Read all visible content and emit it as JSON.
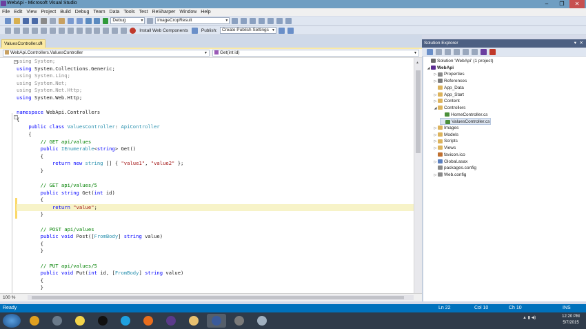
{
  "window": {
    "title": "WebApi - Microsoft Visual Studio",
    "controls": [
      "–",
      "❐",
      "✕"
    ]
  },
  "menubar": {
    "items": [
      "File",
      "Edit",
      "View",
      "Project",
      "Build",
      "Debug",
      "Team",
      "Data",
      "Tools",
      "Test",
      "ReSharper",
      "Window",
      "Help"
    ]
  },
  "toolbar1": {
    "config": "Debug",
    "find": "imageCropResult"
  },
  "toolbar2": {
    "install_label": "Install Web Components",
    "publish_label": "Publish:",
    "publish_profile": "Create Publish Settings"
  },
  "tabs": {
    "active": "ValuesController.cs",
    "close": "✕"
  },
  "navbar": {
    "type": "WebApi.Controllers.ValuesController",
    "member": "Get(int id)"
  },
  "editor": {
    "zoom": "100 %",
    "lines": [
      [
        [
          "gr",
          "using System;"
        ]
      ],
      [
        [
          "kw",
          "using"
        ],
        [
          "",
          "System.Collections.Generic;"
        ]
      ],
      [
        [
          "gr",
          "using System.Linq;"
        ]
      ],
      [
        [
          "gr",
          "using System.Net;"
        ]
      ],
      [
        [
          "gr",
          "using System.Net.Http;"
        ]
      ],
      [
        [
          "kw",
          "using"
        ],
        [
          "",
          "System.Web.Http;"
        ]
      ],
      [
        [
          "",
          ""
        ]
      ],
      [
        [
          "kw",
          "namespace"
        ],
        [
          "",
          "WebApi.Controllers"
        ]
      ],
      [
        [
          "",
          "{"
        ]
      ],
      [
        [
          "",
          "    "
        ],
        [
          "kw",
          "public class"
        ],
        [
          "",
          ""
        ],
        [
          "ty",
          "ValuesController"
        ],
        [
          "",
          ":"
        ],
        [
          "ty",
          "ApiController"
        ]
      ],
      [
        [
          "",
          "    {"
        ]
      ],
      [
        [
          "",
          "        "
        ],
        [
          "cm",
          "// GET api/values"
        ]
      ],
      [
        [
          "",
          "        "
        ],
        [
          "kw",
          "public"
        ],
        [
          "",
          ""
        ],
        [
          "ty",
          "IEnumerable"
        ],
        [
          "",
          "<"
        ],
        [
          "kw",
          "string"
        ],
        [
          "",
          "> Get()"
        ]
      ],
      [
        [
          "",
          "        {"
        ]
      ],
      [
        [
          "",
          "            "
        ],
        [
          "kw",
          "return new"
        ],
        [
          "",
          ""
        ],
        [
          "ty",
          "string"
        ],
        [
          "",
          "[] { "
        ],
        [
          "str",
          "\"value1\""
        ],
        [
          "",
          ", "
        ],
        [
          "str",
          "\"value2\""
        ],
        [
          "",
          " };"
        ]
      ],
      [
        [
          "",
          "        }"
        ]
      ],
      [
        [
          "",
          ""
        ]
      ],
      [
        [
          "",
          "        "
        ],
        [
          "cm",
          "// GET api/values/5"
        ]
      ],
      [
        [
          "",
          "        "
        ],
        [
          "kw",
          "public string"
        ],
        [
          "",
          "Get("
        ],
        [
          "kw",
          "int"
        ],
        [
          "",
          "id)"
        ]
      ],
      [
        [
          "",
          "        {"
        ]
      ],
      [
        [
          "",
          "            "
        ],
        [
          "kw",
          "return"
        ],
        [
          "",
          ""
        ],
        [
          "str",
          "\"value\""
        ],
        [
          "",
          ";"
        ]
      ],
      [
        [
          "",
          "        }"
        ]
      ],
      [
        [
          "",
          ""
        ]
      ],
      [
        [
          "",
          "        "
        ],
        [
          "cm",
          "// POST api/values"
        ]
      ],
      [
        [
          "",
          "        "
        ],
        [
          "kw",
          "public void"
        ],
        [
          "",
          "Post(["
        ],
        [
          "ty",
          "FromBody"
        ],
        [
          "",
          "]"
        ],
        [
          "kw",
          "string"
        ],
        [
          "",
          "value)"
        ]
      ],
      [
        [
          "",
          "        {"
        ]
      ],
      [
        [
          "",
          "        }"
        ]
      ],
      [
        [
          "",
          ""
        ]
      ],
      [
        [
          "",
          "        "
        ],
        [
          "cm",
          "// PUT api/values/5"
        ]
      ],
      [
        [
          "",
          "        "
        ],
        [
          "kw",
          "public void"
        ],
        [
          "",
          "Put("
        ],
        [
          "kw",
          "int"
        ],
        [
          "",
          "id, ["
        ],
        [
          "ty",
          "FromBody"
        ],
        [
          "",
          "]"
        ],
        [
          "kw",
          "string"
        ],
        [
          "",
          "value)"
        ]
      ],
      [
        [
          "",
          "        {"
        ]
      ],
      [
        [
          "",
          "        }"
        ]
      ]
    ]
  },
  "solution_explorer": {
    "title": "Solution Explorer",
    "items": [
      {
        "label": "Solution 'WebApi' (1 project)",
        "depth": 0,
        "toggle": "",
        "color": "#6b6b6b"
      },
      {
        "label": "WebApi",
        "depth": 0,
        "toggle": "◢",
        "color": "#5c2d91",
        "bold": true
      },
      {
        "label": "Properties",
        "depth": 1,
        "toggle": "▷",
        "color": "#8a8a8a"
      },
      {
        "label": "References",
        "depth": 1,
        "toggle": "▷",
        "color": "#7a7a7a"
      },
      {
        "label": "App_Data",
        "depth": 1,
        "toggle": "",
        "color": "#dcb35c"
      },
      {
        "label": "App_Start",
        "depth": 1,
        "toggle": "▷",
        "color": "#dcb35c"
      },
      {
        "label": "Content",
        "depth": 1,
        "toggle": "▷",
        "color": "#dcb35c"
      },
      {
        "label": "Controllers",
        "depth": 1,
        "toggle": "◢",
        "color": "#dcb35c"
      },
      {
        "label": "HomeController.cs",
        "depth": 2,
        "toggle": "",
        "color": "#4b8f3a"
      },
      {
        "label": "ValuesController.cs",
        "depth": 2,
        "toggle": "",
        "color": "#4b8f3a",
        "selected": true
      },
      {
        "label": "Images",
        "depth": 1,
        "toggle": "▷",
        "color": "#dcb35c"
      },
      {
        "label": "Models",
        "depth": 1,
        "toggle": "▷",
        "color": "#dcb35c"
      },
      {
        "label": "Scripts",
        "depth": 1,
        "toggle": "▷",
        "color": "#dcb35c"
      },
      {
        "label": "Views",
        "depth": 1,
        "toggle": "▷",
        "color": "#dcb35c"
      },
      {
        "label": "favicon.ico",
        "depth": 1,
        "toggle": "",
        "color": "#c07030"
      },
      {
        "label": "Global.asax",
        "depth": 1,
        "toggle": "▷",
        "color": "#5a7fbf"
      },
      {
        "label": "packages.config",
        "depth": 1,
        "toggle": "",
        "color": "#8a8a8a"
      },
      {
        "label": "Web.config",
        "depth": 1,
        "toggle": "▷",
        "color": "#8a8a8a"
      }
    ]
  },
  "statusbar": {
    "left": "Ready",
    "ln": "Ln 22",
    "col": "Col 10",
    "ch": "Ch 10",
    "mode": "INS"
  },
  "taskbar": {
    "apps": [
      {
        "name": "Chrome",
        "color": "#e0a020"
      },
      {
        "name": "App2",
        "color": "#6a7a8a"
      },
      {
        "name": "Sticky",
        "color": "#f2d34a"
      },
      {
        "name": "P",
        "color": "#111111"
      },
      {
        "name": "Skype",
        "color": "#1ea0e0"
      },
      {
        "name": "Firefox",
        "color": "#e86d1d"
      },
      {
        "name": "App7",
        "color": "#5a3a8a"
      },
      {
        "name": "Explorer",
        "color": "#e8c070"
      },
      {
        "name": "VisualStudio",
        "color": "#3a5a9a"
      },
      {
        "name": "Tools",
        "color": "#7a7a7a"
      },
      {
        "name": "Paint",
        "color": "#a0b0c0"
      }
    ],
    "time": "12:20 PM",
    "date": "5/7/2015"
  }
}
